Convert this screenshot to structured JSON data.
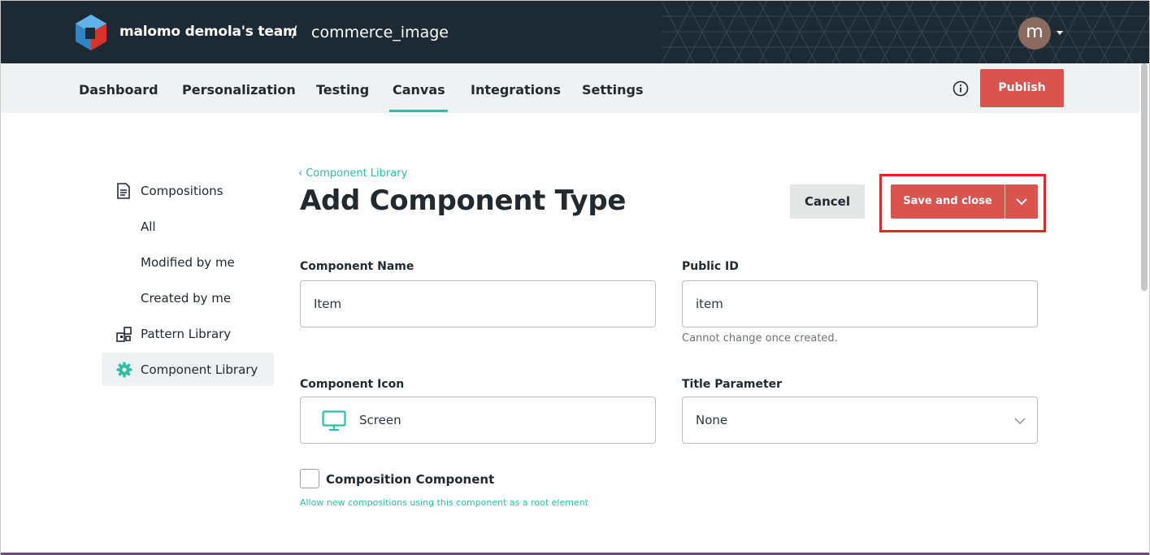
{
  "header": {
    "team": "malomo demola's team",
    "separator": "/",
    "project": "commerce_image",
    "avatar_letter": "m"
  },
  "nav": {
    "tabs": [
      {
        "label": "Dashboard"
      },
      {
        "label": "Personalization"
      },
      {
        "label": "Testing"
      },
      {
        "label": "Canvas",
        "active": true
      },
      {
        "label": "Integrations"
      },
      {
        "label": "Settings"
      }
    ],
    "publish_label": "Publish"
  },
  "sidebar": {
    "items": [
      {
        "label": "Compositions",
        "icon": "document-icon"
      },
      {
        "label": "All"
      },
      {
        "label": "Modified by me"
      },
      {
        "label": "Created by me"
      },
      {
        "label": "Pattern Library",
        "icon": "pattern-icon"
      },
      {
        "label": "Component Library",
        "icon": "gear-icon",
        "active": true
      }
    ]
  },
  "main": {
    "breadcrumb": "Component Library",
    "title": "Add Component Type",
    "cancel_label": "Cancel",
    "save_label": "Save and close",
    "fields": {
      "component_name": {
        "label": "Component Name",
        "value": "Item"
      },
      "public_id": {
        "label": "Public ID",
        "value": "item",
        "hint": "Cannot change once created."
      },
      "component_icon": {
        "label": "Component Icon",
        "value": "Screen",
        "icon": "screen-icon"
      },
      "title_parameter": {
        "label": "Title Parameter",
        "value": "None"
      }
    },
    "composition_component": {
      "label": "Composition Component",
      "checked": false,
      "help": "Allow new compositions using this component as a root element"
    }
  },
  "colors": {
    "topbar": "#1e2a33",
    "accent": "#2bbfa3",
    "primary_button": "#d9534f",
    "highlight": "#e8251c"
  }
}
